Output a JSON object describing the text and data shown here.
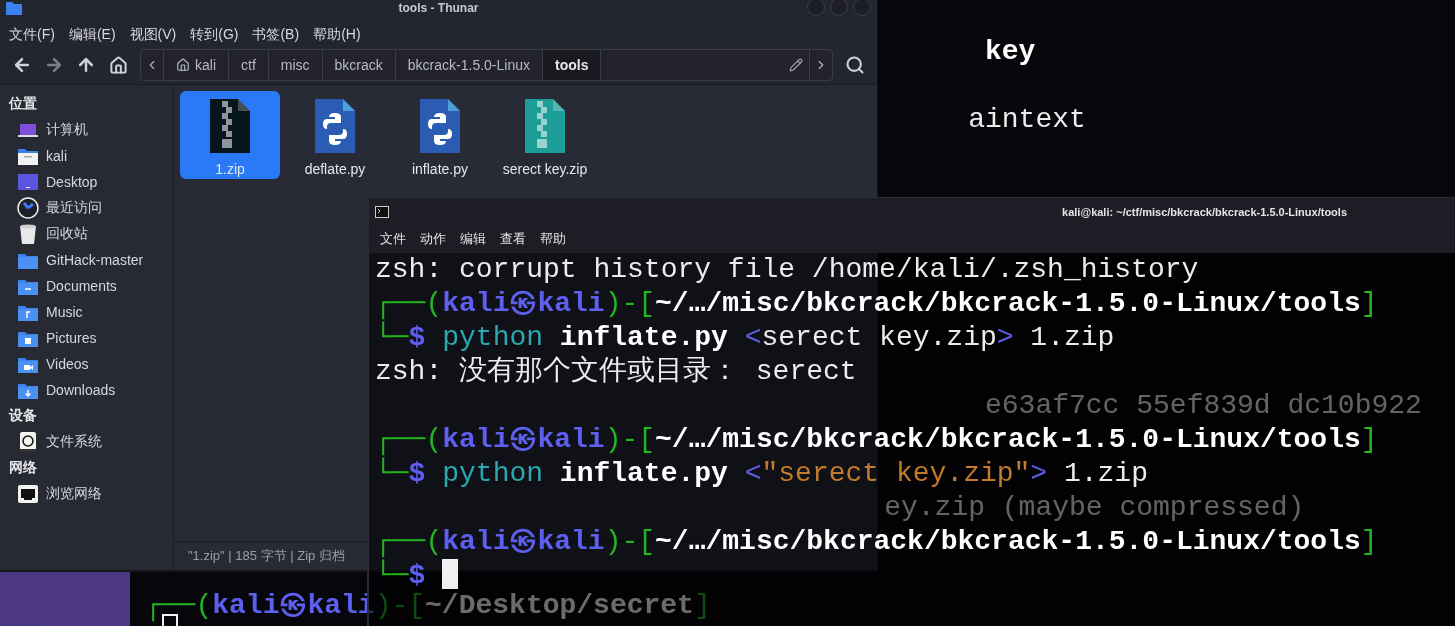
{
  "back_terminal": {
    "lines": [
      {
        "cursor": false,
        "segments": [
          {
            "text": "key",
            "kind": "argument"
          }
        ]
      },
      {
        "cursor": false,
        "segments": [
          {
            "text": "aintext",
            "kind": "plain"
          }
        ]
      },
      {
        "cursor": false,
        "segments": [
          {
            "text": "e63af7cc 55ef839d dc10b922",
            "kind": "plain"
          }
        ]
      },
      {
        "cursor": false,
        "segments": [
          {
            "text": "ey.zip (maybe compressed)",
            "kind": "plain"
          }
        ]
      },
      {
        "cursor": false,
        "segments": [
          {
            "text": "┌──(",
            "kind": "frame"
          },
          {
            "text": "kali㉿kali",
            "kind": "user"
          },
          {
            "text": ")-[",
            "kind": "frame"
          },
          {
            "text": "~/Desktop/secret",
            "kind": "path"
          },
          {
            "text": "]",
            "kind": "frame"
          }
        ]
      },
      {
        "cursor": true
      }
    ]
  },
  "thunar": {
    "title": "tools - Thunar",
    "menu": [
      "文件(F)",
      "编辑(E)",
      "视图(V)",
      "转到(G)",
      "书签(B)",
      "帮助(H)"
    ],
    "path": [
      {
        "label": "kali",
        "kind": "home",
        "selected": false
      },
      {
        "label": "ctf",
        "kind": "folder",
        "selected": false
      },
      {
        "label": "misc",
        "kind": "folder",
        "selected": false
      },
      {
        "label": "bkcrack",
        "kind": "folder",
        "selected": false
      },
      {
        "label": "bkcrack-1.5.0-Linux",
        "kind": "folder",
        "selected": false
      },
      {
        "label": "tools",
        "kind": "folder",
        "selected": true
      }
    ],
    "sidebar": [
      {
        "heading": "位置",
        "items": [
          {
            "label": "计算机",
            "kind": "computer"
          },
          {
            "label": "kali",
            "kind": "home"
          },
          {
            "label": "Desktop",
            "kind": "desktop"
          },
          {
            "label": "最近访问",
            "kind": "recent"
          },
          {
            "label": "回收站",
            "kind": "trash"
          },
          {
            "label": "GitHack-master",
            "kind": "folder"
          },
          {
            "label": "Documents",
            "kind": "documents"
          },
          {
            "label": "Music",
            "kind": "music"
          },
          {
            "label": "Pictures",
            "kind": "pictures"
          },
          {
            "label": "Videos",
            "kind": "videos"
          },
          {
            "label": "Downloads",
            "kind": "downloads"
          }
        ]
      },
      {
        "heading": "设备",
        "items": [
          {
            "label": "文件系统",
            "kind": "drive"
          }
        ]
      },
      {
        "heading": "网络",
        "items": [
          {
            "label": "浏览网络",
            "kind": "network"
          }
        ]
      }
    ],
    "files": [
      {
        "name": "1.zip",
        "kind": "archive",
        "color": "#07161c",
        "selected": true
      },
      {
        "name": "deflate.py",
        "kind": "python",
        "color": "#2a5cb3",
        "selected": false
      },
      {
        "name": "inflate.py",
        "kind": "python",
        "color": "#2a5cb3",
        "selected": false
      },
      {
        "name": "serect key.zip",
        "kind": "archive",
        "color": "#1c9d98",
        "selected": false
      }
    ],
    "status": "\"1.zip\" | 185 字节 | Zip 归档"
  },
  "front_terminal": {
    "title": "kali@kali: ~/ctf/misc/bkcrack/bkcrack-1.5.0-Linux/tools",
    "menu": [
      "文件",
      "动作",
      "编辑",
      "查看",
      "帮助"
    ],
    "lines": [
      {
        "cursor": false,
        "segments": [
          {
            "text": "zsh: corrupt history file /home/kali/.zsh_history",
            "kind": "plain"
          }
        ]
      },
      {
        "cursor": false,
        "segments": [
          {
            "text": "┌──(",
            "kind": "frame"
          },
          {
            "text": "kali㉿kali",
            "kind": "user"
          },
          {
            "text": ")-[",
            "kind": "frame"
          },
          {
            "text": "~/…/misc/bkcrack/bkcrack-1.5.0-Linux/tools",
            "kind": "path"
          },
          {
            "text": "]",
            "kind": "frame"
          }
        ]
      },
      {
        "cursor": false,
        "segments": [
          {
            "text": "└─",
            "kind": "frame"
          },
          {
            "text": "$",
            "kind": "prompt"
          },
          {
            "text": " python",
            "kind": "command"
          },
          {
            "text": " inflate.py",
            "kind": "argument"
          },
          {
            "text": " <",
            "kind": "operator"
          },
          {
            "text": "serect key.zip",
            "kind": "plain"
          },
          {
            "text": ">",
            "kind": "operator"
          },
          {
            "text": " 1.zip",
            "kind": "plain"
          }
        ]
      },
      {
        "cursor": false,
        "segments": [
          {
            "text": "zsh: 没有那个文件或目录： serect",
            "kind": "plain"
          }
        ]
      },
      {
        "cursor": false
      },
      {
        "cursor": false,
        "segments": [
          {
            "text": "┌──(",
            "kind": "frame"
          },
          {
            "text": "kali㉿kali",
            "kind": "user"
          },
          {
            "text": ")-[",
            "kind": "frame"
          },
          {
            "text": "~/…/misc/bkcrack/bkcrack-1.5.0-Linux/tools",
            "kind": "path"
          },
          {
            "text": "]",
            "kind": "frame"
          }
        ]
      },
      {
        "cursor": false,
        "segments": [
          {
            "text": "└─",
            "kind": "frame"
          },
          {
            "text": "$",
            "kind": "prompt"
          },
          {
            "text": " python",
            "kind": "command"
          },
          {
            "text": " inflate.py",
            "kind": "argument"
          },
          {
            "text": " <",
            "kind": "operator"
          },
          {
            "text": "\"serect key.zip\"",
            "kind": "string"
          },
          {
            "text": ">",
            "kind": "operator"
          },
          {
            "text": " 1.zip",
            "kind": "plain"
          }
        ]
      },
      {
        "cursor": false
      },
      {
        "cursor": false,
        "segments": [
          {
            "text": "┌──(",
            "kind": "frame"
          },
          {
            "text": "kali㉿kali",
            "kind": "user"
          },
          {
            "text": ")-[",
            "kind": "frame"
          },
          {
            "text": "~/…/misc/bkcrack/bkcrack-1.5.0-Linux/tools",
            "kind": "path"
          },
          {
            "text": "]",
            "kind": "frame"
          }
        ]
      },
      {
        "cursor": true,
        "segments": [
          {
            "text": "└─",
            "kind": "frame"
          },
          {
            "text": "$",
            "kind": "prompt"
          }
        ]
      }
    ]
  }
}
